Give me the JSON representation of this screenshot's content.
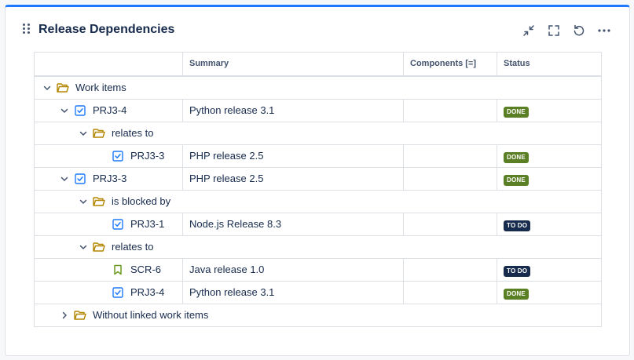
{
  "panel": {
    "title": "Release Dependencies",
    "actions": [
      "collapse-icon",
      "fullscreen-icon",
      "refresh-icon",
      "more-icon"
    ]
  },
  "columns": {
    "summary": "Summary",
    "components": "Components [≡]",
    "status": "Status"
  },
  "rows": [
    {
      "level": 0,
      "type": "group",
      "expanded": true,
      "label": "Work items"
    },
    {
      "level": 1,
      "type": "item",
      "icon": "checkbox-icon",
      "expanded": true,
      "key": "PRJ3-4",
      "summary": "Python release 3.1",
      "status": "DONE"
    },
    {
      "level": 2,
      "type": "group",
      "expanded": true,
      "label": "relates to"
    },
    {
      "level": 3,
      "type": "item",
      "icon": "checkbox-icon",
      "key": "PRJ3-3",
      "summary": "PHP release 2.5",
      "status": "DONE"
    },
    {
      "level": 1,
      "type": "item",
      "icon": "checkbox-icon",
      "expanded": true,
      "key": "PRJ3-3",
      "summary": "PHP release 2.5",
      "status": "DONE"
    },
    {
      "level": 2,
      "type": "group",
      "expanded": true,
      "label": "is blocked by"
    },
    {
      "level": 3,
      "type": "item",
      "icon": "checkbox-icon",
      "key": "PRJ3-1",
      "summary": "Node.js Release 8.3",
      "status": "TO DO"
    },
    {
      "level": 2,
      "type": "group",
      "expanded": true,
      "label": "relates to"
    },
    {
      "level": 3,
      "type": "item",
      "icon": "bookmark-icon",
      "key": "SCR-6",
      "summary": "Java release 1.0",
      "status": "TO DO"
    },
    {
      "level": 3,
      "type": "item",
      "icon": "checkbox-icon",
      "key": "PRJ3-4",
      "summary": "Python release 3.1",
      "status": "DONE"
    },
    {
      "level": 1,
      "type": "group",
      "expanded": false,
      "label": "Without linked work items"
    }
  ],
  "colors": {
    "accent": "#1d7afc",
    "done": "#5b7f24",
    "todo": "#172b4d",
    "folder": "#b38600",
    "story": "#6a9a23"
  }
}
